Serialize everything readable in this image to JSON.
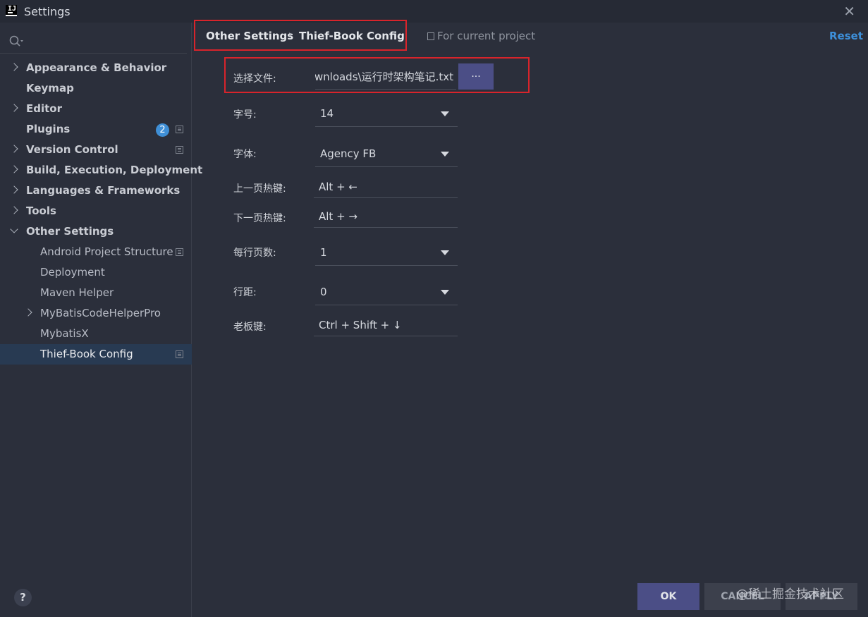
{
  "window": {
    "title": "Settings"
  },
  "breadcrumb": {
    "parent": "Other Settings",
    "separator": "›",
    "current": "Thief-Book Config"
  },
  "scope_label": "For current project",
  "reset_label": "Reset",
  "sidebar": {
    "items": [
      {
        "label": "Appearance & Behavior"
      },
      {
        "label": "Keymap"
      },
      {
        "label": "Editor"
      },
      {
        "label": "Plugins",
        "badge": "2"
      },
      {
        "label": "Version Control"
      },
      {
        "label": "Build, Execution, Deployment"
      },
      {
        "label": "Languages & Frameworks"
      },
      {
        "label": "Tools"
      },
      {
        "label": "Other Settings"
      },
      {
        "label": "Android Project Structure"
      },
      {
        "label": "Deployment"
      },
      {
        "label": "Maven Helper"
      },
      {
        "label": "MyBatisCodeHelperPro"
      },
      {
        "label": "MybatisX"
      },
      {
        "label": "Thief-Book Config"
      }
    ]
  },
  "form": {
    "file": {
      "label": "选择文件:",
      "value": "wnloads\\运行时架构笔记.txt",
      "browse": "..."
    },
    "font_size": {
      "label": "字号:",
      "value": "14"
    },
    "font": {
      "label": "字体:",
      "value": "Agency FB"
    },
    "prev_hotkey": {
      "label": "上一页热键:",
      "value": "Alt + ←"
    },
    "next_hotkey": {
      "label": "下一页热键:",
      "value": "Alt + →"
    },
    "pages_per_row": {
      "label": "每行页数:",
      "value": "1"
    },
    "line_spacing": {
      "label": "行距:",
      "value": "0"
    },
    "boss_key": {
      "label": "老板键:",
      "value": "Ctrl + Shift + ↓"
    }
  },
  "footer": {
    "ok": "OK",
    "cancel": "CANCEL",
    "apply": "APPLY",
    "help": "?"
  },
  "watermark": "@稀土掘金技术社区",
  "colors": {
    "accent": "#3d8fd9",
    "highlight_border": "#d8242b",
    "primary_button": "#4b4e86"
  }
}
